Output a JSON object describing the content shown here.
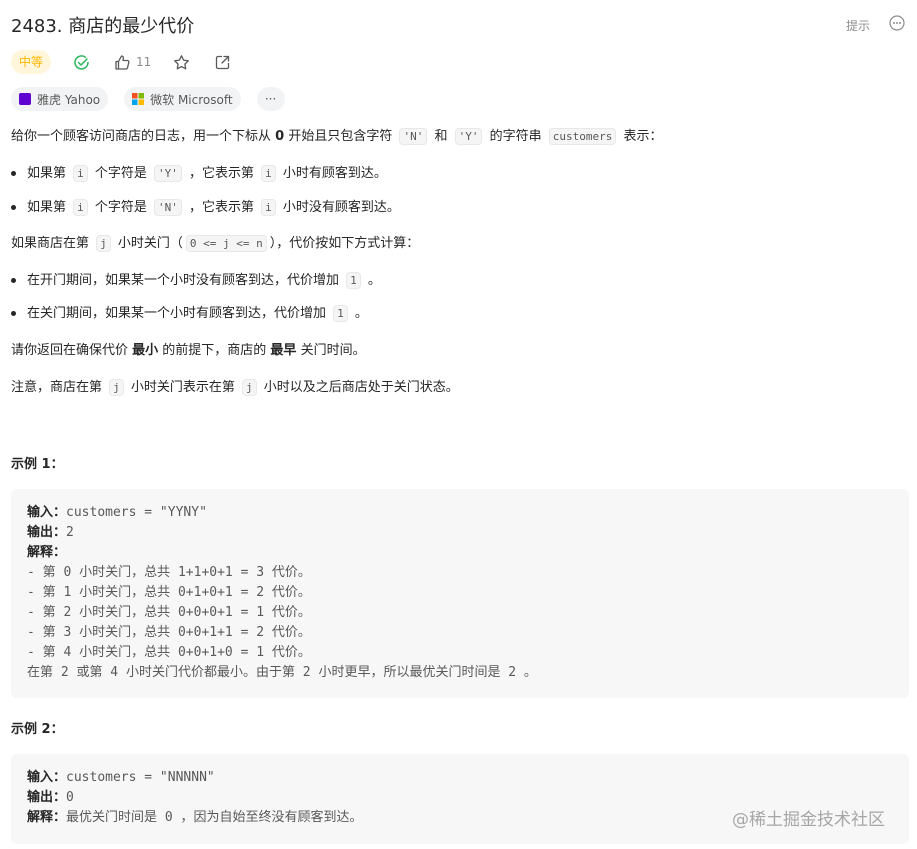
{
  "problem": {
    "title": "2483. 商店的最少代价",
    "hint_label": "提示",
    "difficulty": "中等",
    "like_count": "11",
    "tags": [
      {
        "label": "雅虎 Yahoo"
      },
      {
        "label": "微软 Microsoft"
      }
    ],
    "more_tags": "···"
  },
  "description": {
    "intro": {
      "a": "给你一个顾客访问商店的日志，用一个下标从 ",
      "b": "0",
      "c": " 开始且只包含字符 ",
      "d": "'N'",
      "e": " 和 ",
      "f": "'Y'",
      "g": " 的字符串 ",
      "h": "customers",
      "i": " 表示："
    },
    "bullet1": {
      "a": "如果第 ",
      "b": "i",
      "c": " 个字符是 ",
      "d": "'Y'",
      "e": " ，它表示第 ",
      "f": "i",
      "g": " 小时有顾客到达。"
    },
    "bullet2": {
      "a": "如果第 ",
      "b": "i",
      "c": " 个字符是 ",
      "d": "'N'",
      "e": " ，它表示第 ",
      "f": "i",
      "g": " 小时没有顾客到达。"
    },
    "closing": {
      "a": "如果商店在第 ",
      "b": "j",
      "c": " 小时关门（",
      "d": "0 <= j <= n",
      "e": "），代价按如下方式计算："
    },
    "bullet3": {
      "a": "在开门期间，如果某一个小时没有顾客到达，代价增加 ",
      "b": "1",
      "c": " 。"
    },
    "bullet4": {
      "a": "在关门期间，如果某一个小时有顾客到达，代价增加 ",
      "b": "1",
      "c": " 。"
    },
    "ask": {
      "a": "请你返回在确保代价 ",
      "b": "最小",
      "c": " 的前提下，商店的 ",
      "d": "最早",
      "e": " 关门时间。"
    },
    "note": {
      "a": "注意，商店在第 ",
      "b": "j",
      "c": " 小时关门表示在第 ",
      "d": "j",
      "e": " 小时以及之后商店处于关门状态。"
    }
  },
  "examples": [
    {
      "title": "示例 1：",
      "input_label": "输入：",
      "input": "customers = \"YYNY\"",
      "output_label": "输出：",
      "output": "2",
      "explain_label": "解释：",
      "lines": [
        "- 第 0 小时关门，总共 1+1+0+1 = 3 代价。",
        "- 第 1 小时关门，总共 0+1+0+1 = 2 代价。",
        "- 第 2 小时关门，总共 0+0+0+1 = 1 代价。",
        "- 第 3 小时关门，总共 0+0+1+1 = 2 代价。",
        "- 第 4 小时关门，总共 0+0+1+0 = 1 代价。",
        "在第 2 或第 4 小时关门代价都最小。由于第 2 小时更早，所以最优关门时间是 2 。"
      ]
    },
    {
      "title": "示例 2：",
      "input_label": "输入：",
      "input": "customers = \"NNNNN\"",
      "output_label": "输出：",
      "output": "0",
      "explain_label": "解释：",
      "explain": "最优关门时间是 0 ，因为自始至终没有顾客到达。"
    }
  ],
  "watermark": "@稀土掘金技术社区"
}
